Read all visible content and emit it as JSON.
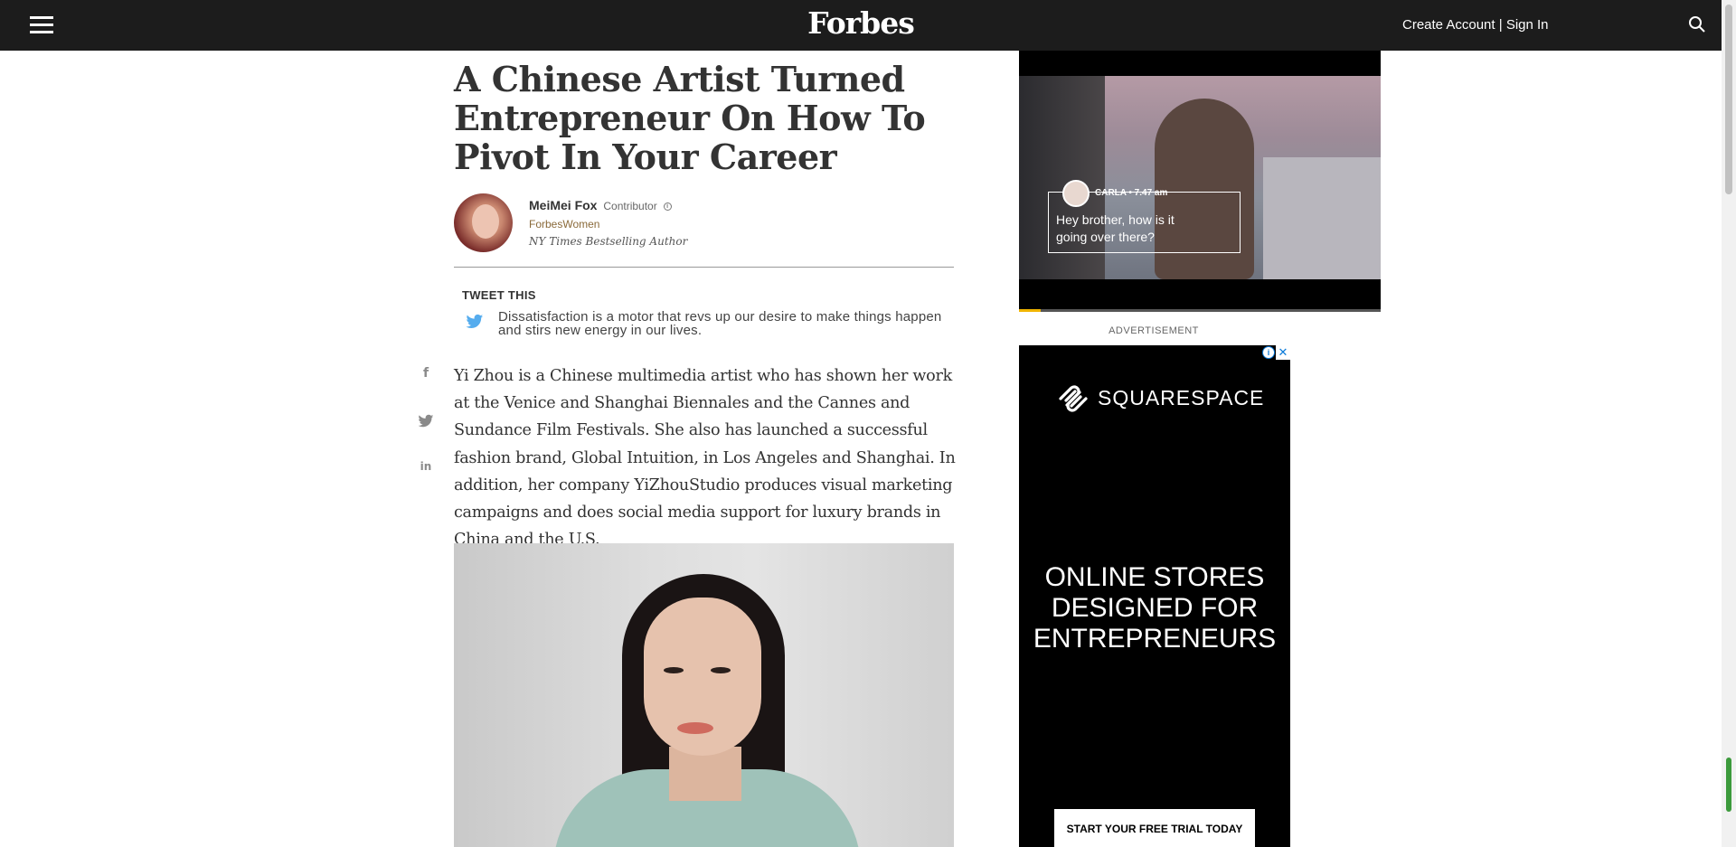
{
  "header": {
    "logo": "Forbes",
    "create_account": "Create Account",
    "separator": "|",
    "sign_in": "Sign In"
  },
  "article": {
    "headline": "A Chinese Artist Turned Entrepreneur On How To Pivot In Your Career",
    "author": {
      "name": "MeiMei Fox",
      "role": "Contributor",
      "info": "i",
      "section": "ForbesWomen",
      "title": "NY Times Bestselling Author"
    },
    "tweet": {
      "label": "TWEET THIS",
      "text": "Dissatisfaction is a motor that revs up our desire to make things happen and stirs new energy in our lives."
    },
    "share": {
      "facebook": "f",
      "twitter": "🐦",
      "linkedin": "in"
    },
    "body": "Yi Zhou is a Chinese multimedia artist who has shown her work at the Venice and Shanghai Biennales and the Cannes and Sundance Film Festivals. She also has launched a successful fashion brand, Global Intuition, in Los Angeles and Shanghai. In addition, her company YiZhouStudio produces visual marketing campaigns and does social media support for luxury brands in China and the U.S."
  },
  "video": {
    "bubble_name": "CARLA • 7.47 am",
    "bubble_text": "Hey brother, how is it going over there?",
    "progress": 0.06
  },
  "ad": {
    "label": "ADVERTISEMENT",
    "info": "i",
    "close": "✕",
    "brand": "SQUARESPACE",
    "headline_lines": [
      "ONLINE STORES",
      "DESIGNED FOR",
      "ENTREPRENEURS"
    ],
    "cta": "START YOUR FREE TRIAL TODAY"
  },
  "icons": {
    "menu": "hamburger-menu-icon",
    "search": "search-icon",
    "twitter_bird": "twitter-bird-icon"
  },
  "colors": {
    "topbar": "#1c1c1c",
    "section_link": "#8a6a3a",
    "twitter_blue": "#55acee",
    "ad_background": "#000000",
    "video_progress": "#f0b400"
  }
}
